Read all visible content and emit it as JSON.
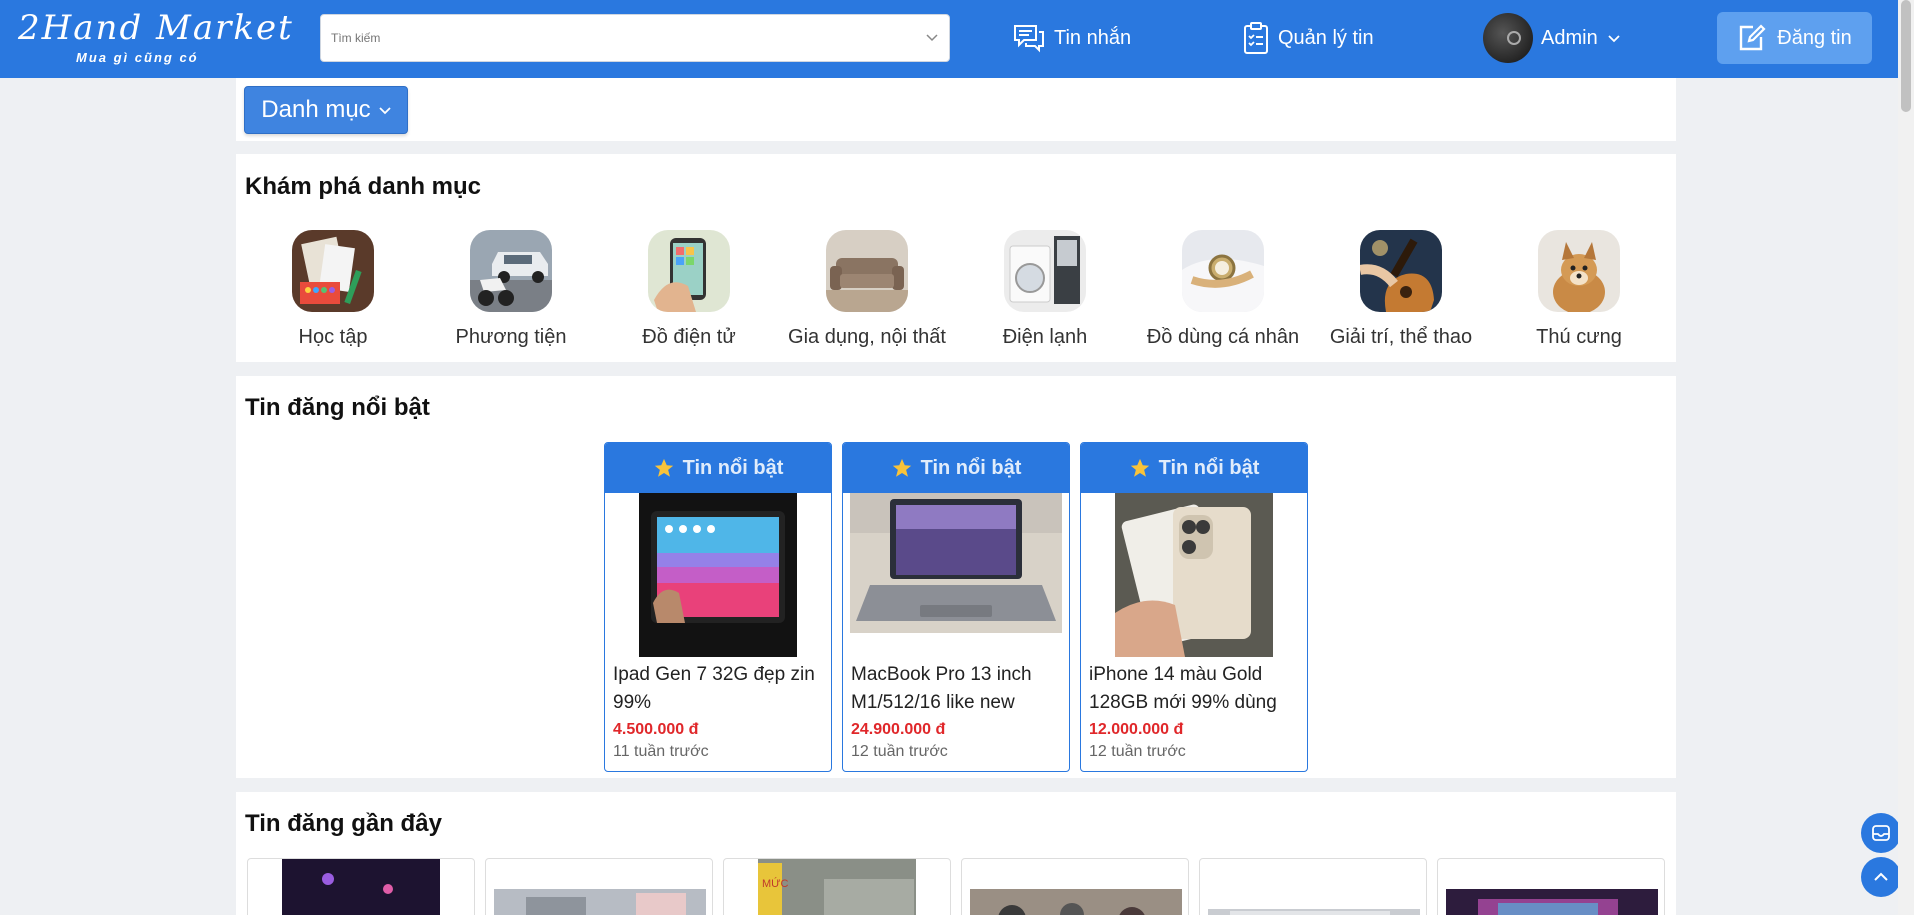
{
  "header": {
    "logo_main": "2Hand Market",
    "logo_sub": "Mua gì cũng có",
    "search_placeholder": "Tìm kiếm",
    "messages_label": "Tin nhắn",
    "manage_label": "Quản lý tin",
    "user_label": "Admin",
    "post_label": "Đăng tin"
  },
  "category_button": "Danh mục",
  "explore": {
    "title": "Khám phá danh mục",
    "items": [
      {
        "label": "Học tập",
        "color": "#c9a06a"
      },
      {
        "label": "Phương tiện",
        "color": "#8c9aa8"
      },
      {
        "label": "Đồ điện tử",
        "color": "#b9c7a8"
      },
      {
        "label": "Gia dụng, nội thất",
        "color": "#a88a6c"
      },
      {
        "label": "Điện lạnh",
        "color": "#d9d9d9"
      },
      {
        "label": "Đồ dùng cá nhân",
        "color": "#c8ccd4"
      },
      {
        "label": "Giải trí, thể thao",
        "color": "#37506e"
      },
      {
        "label": "Thú cưng",
        "color": "#c99a5a"
      }
    ]
  },
  "featured": {
    "title": "Tin đăng nổi bật",
    "badge": "Tin nổi bật",
    "items": [
      {
        "title": "Ipad Gen 7 32G đẹp zin 99%",
        "price": "4.500.000 đ",
        "time": "11 tuần trước"
      },
      {
        "title": "MacBook Pro 13 inch M1/512/16 like new",
        "price": "24.900.000 đ",
        "time": "12 tuần trước"
      },
      {
        "title": "iPhone 14 màu Gold 128GB mới 99% dùng",
        "price": "12.000.000 đ",
        "time": "12 tuần trước"
      }
    ]
  },
  "recent": {
    "title": "Tin đăng gần đây"
  },
  "colors": {
    "primary": "#2a78df",
    "price": "#e0272a",
    "background": "#eef0f3"
  }
}
